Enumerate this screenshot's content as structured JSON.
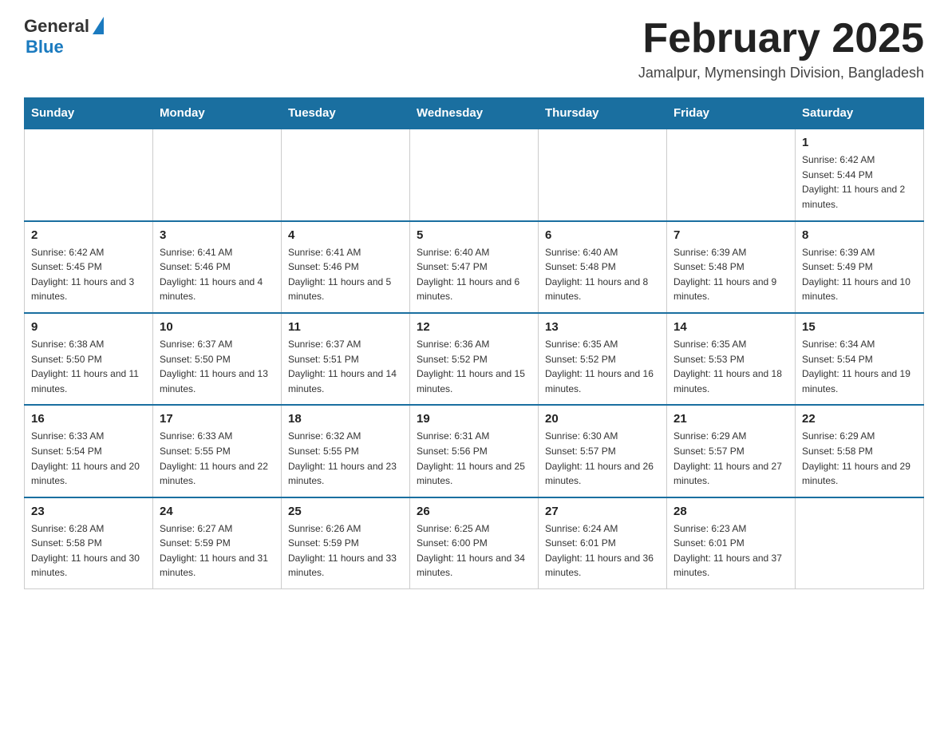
{
  "header": {
    "logo_text": "General",
    "logo_blue": "Blue",
    "month_title": "February 2025",
    "location": "Jamalpur, Mymensingh Division, Bangladesh"
  },
  "days_of_week": [
    "Sunday",
    "Monday",
    "Tuesday",
    "Wednesday",
    "Thursday",
    "Friday",
    "Saturday"
  ],
  "weeks": [
    [
      {
        "day": "",
        "sunrise": "",
        "sunset": "",
        "daylight": ""
      },
      {
        "day": "",
        "sunrise": "",
        "sunset": "",
        "daylight": ""
      },
      {
        "day": "",
        "sunrise": "",
        "sunset": "",
        "daylight": ""
      },
      {
        "day": "",
        "sunrise": "",
        "sunset": "",
        "daylight": ""
      },
      {
        "day": "",
        "sunrise": "",
        "sunset": "",
        "daylight": ""
      },
      {
        "day": "",
        "sunrise": "",
        "sunset": "",
        "daylight": ""
      },
      {
        "day": "1",
        "sunrise": "Sunrise: 6:42 AM",
        "sunset": "Sunset: 5:44 PM",
        "daylight": "Daylight: 11 hours and 2 minutes."
      }
    ],
    [
      {
        "day": "2",
        "sunrise": "Sunrise: 6:42 AM",
        "sunset": "Sunset: 5:45 PM",
        "daylight": "Daylight: 11 hours and 3 minutes."
      },
      {
        "day": "3",
        "sunrise": "Sunrise: 6:41 AM",
        "sunset": "Sunset: 5:46 PM",
        "daylight": "Daylight: 11 hours and 4 minutes."
      },
      {
        "day": "4",
        "sunrise": "Sunrise: 6:41 AM",
        "sunset": "Sunset: 5:46 PM",
        "daylight": "Daylight: 11 hours and 5 minutes."
      },
      {
        "day": "5",
        "sunrise": "Sunrise: 6:40 AM",
        "sunset": "Sunset: 5:47 PM",
        "daylight": "Daylight: 11 hours and 6 minutes."
      },
      {
        "day": "6",
        "sunrise": "Sunrise: 6:40 AM",
        "sunset": "Sunset: 5:48 PM",
        "daylight": "Daylight: 11 hours and 8 minutes."
      },
      {
        "day": "7",
        "sunrise": "Sunrise: 6:39 AM",
        "sunset": "Sunset: 5:48 PM",
        "daylight": "Daylight: 11 hours and 9 minutes."
      },
      {
        "day": "8",
        "sunrise": "Sunrise: 6:39 AM",
        "sunset": "Sunset: 5:49 PM",
        "daylight": "Daylight: 11 hours and 10 minutes."
      }
    ],
    [
      {
        "day": "9",
        "sunrise": "Sunrise: 6:38 AM",
        "sunset": "Sunset: 5:50 PM",
        "daylight": "Daylight: 11 hours and 11 minutes."
      },
      {
        "day": "10",
        "sunrise": "Sunrise: 6:37 AM",
        "sunset": "Sunset: 5:50 PM",
        "daylight": "Daylight: 11 hours and 13 minutes."
      },
      {
        "day": "11",
        "sunrise": "Sunrise: 6:37 AM",
        "sunset": "Sunset: 5:51 PM",
        "daylight": "Daylight: 11 hours and 14 minutes."
      },
      {
        "day": "12",
        "sunrise": "Sunrise: 6:36 AM",
        "sunset": "Sunset: 5:52 PM",
        "daylight": "Daylight: 11 hours and 15 minutes."
      },
      {
        "day": "13",
        "sunrise": "Sunrise: 6:35 AM",
        "sunset": "Sunset: 5:52 PM",
        "daylight": "Daylight: 11 hours and 16 minutes."
      },
      {
        "day": "14",
        "sunrise": "Sunrise: 6:35 AM",
        "sunset": "Sunset: 5:53 PM",
        "daylight": "Daylight: 11 hours and 18 minutes."
      },
      {
        "day": "15",
        "sunrise": "Sunrise: 6:34 AM",
        "sunset": "Sunset: 5:54 PM",
        "daylight": "Daylight: 11 hours and 19 minutes."
      }
    ],
    [
      {
        "day": "16",
        "sunrise": "Sunrise: 6:33 AM",
        "sunset": "Sunset: 5:54 PM",
        "daylight": "Daylight: 11 hours and 20 minutes."
      },
      {
        "day": "17",
        "sunrise": "Sunrise: 6:33 AM",
        "sunset": "Sunset: 5:55 PM",
        "daylight": "Daylight: 11 hours and 22 minutes."
      },
      {
        "day": "18",
        "sunrise": "Sunrise: 6:32 AM",
        "sunset": "Sunset: 5:55 PM",
        "daylight": "Daylight: 11 hours and 23 minutes."
      },
      {
        "day": "19",
        "sunrise": "Sunrise: 6:31 AM",
        "sunset": "Sunset: 5:56 PM",
        "daylight": "Daylight: 11 hours and 25 minutes."
      },
      {
        "day": "20",
        "sunrise": "Sunrise: 6:30 AM",
        "sunset": "Sunset: 5:57 PM",
        "daylight": "Daylight: 11 hours and 26 minutes."
      },
      {
        "day": "21",
        "sunrise": "Sunrise: 6:29 AM",
        "sunset": "Sunset: 5:57 PM",
        "daylight": "Daylight: 11 hours and 27 minutes."
      },
      {
        "day": "22",
        "sunrise": "Sunrise: 6:29 AM",
        "sunset": "Sunset: 5:58 PM",
        "daylight": "Daylight: 11 hours and 29 minutes."
      }
    ],
    [
      {
        "day": "23",
        "sunrise": "Sunrise: 6:28 AM",
        "sunset": "Sunset: 5:58 PM",
        "daylight": "Daylight: 11 hours and 30 minutes."
      },
      {
        "day": "24",
        "sunrise": "Sunrise: 6:27 AM",
        "sunset": "Sunset: 5:59 PM",
        "daylight": "Daylight: 11 hours and 31 minutes."
      },
      {
        "day": "25",
        "sunrise": "Sunrise: 6:26 AM",
        "sunset": "Sunset: 5:59 PM",
        "daylight": "Daylight: 11 hours and 33 minutes."
      },
      {
        "day": "26",
        "sunrise": "Sunrise: 6:25 AM",
        "sunset": "Sunset: 6:00 PM",
        "daylight": "Daylight: 11 hours and 34 minutes."
      },
      {
        "day": "27",
        "sunrise": "Sunrise: 6:24 AM",
        "sunset": "Sunset: 6:01 PM",
        "daylight": "Daylight: 11 hours and 36 minutes."
      },
      {
        "day": "28",
        "sunrise": "Sunrise: 6:23 AM",
        "sunset": "Sunset: 6:01 PM",
        "daylight": "Daylight: 11 hours and 37 minutes."
      },
      {
        "day": "",
        "sunrise": "",
        "sunset": "",
        "daylight": ""
      }
    ]
  ]
}
